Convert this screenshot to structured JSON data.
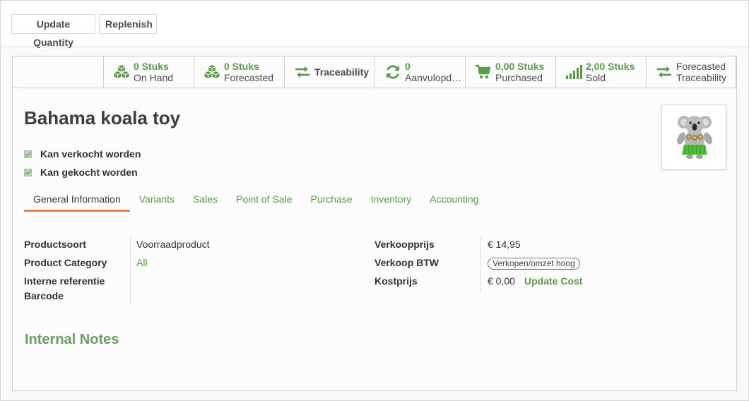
{
  "control_panel": {
    "update_quantity_label": "Update Quantity",
    "replenish_label": "Replenish"
  },
  "smart_buttons": [
    {
      "icon": "cubes-icon",
      "value": "0 Stuks",
      "label": "On Hand"
    },
    {
      "icon": "cubes-icon",
      "value": "0 Stuks",
      "label": "Forecasted"
    },
    {
      "icon": "exchange-icon",
      "label": "Traceability"
    },
    {
      "icon": "refresh-icon",
      "value": "0",
      "label": "Aanvulopd…"
    },
    {
      "icon": "cart-icon",
      "value": "0,00 Stuks",
      "label": "Purchased"
    },
    {
      "icon": "signal-icon",
      "value": "2,00 Stuks",
      "label": "Sold"
    },
    {
      "icon": "exchange-icon",
      "line1": "Forecasted",
      "line2": "Traceability"
    }
  ],
  "product": {
    "title": "Bahama koala toy",
    "can_be_sold_label": "Kan verkocht worden",
    "can_be_purchased_label": "Kan gekocht worden",
    "can_be_sold": true,
    "can_be_purchased": true
  },
  "tabs": [
    {
      "label": "General Information",
      "active": true
    },
    {
      "label": "Variants"
    },
    {
      "label": "Sales"
    },
    {
      "label": "Point of Sale"
    },
    {
      "label": "Purchase"
    },
    {
      "label": "Inventory"
    },
    {
      "label": "Accounting"
    }
  ],
  "general": {
    "product_type_label": "Productsoort",
    "product_type_value": "Voorraadproduct",
    "category_label": "Product Category",
    "category_value": "All",
    "internal_ref_label": "Interne referentie",
    "barcode_label": "Barcode",
    "sales_price_label": "Verkoopprijs",
    "sales_price_value": "€ 14,95",
    "sales_tax_label": "Verkoop BTW",
    "sales_tax_value": "Verkopen/omzet hoog",
    "cost_label": "Kostprijs",
    "cost_value": "€ 0,00",
    "update_cost_label": "Update Cost"
  },
  "internal_notes_title": "Internal Notes",
  "colors": {
    "accent_green": "#5a9a4a",
    "tab_underline": "#e0844a"
  }
}
